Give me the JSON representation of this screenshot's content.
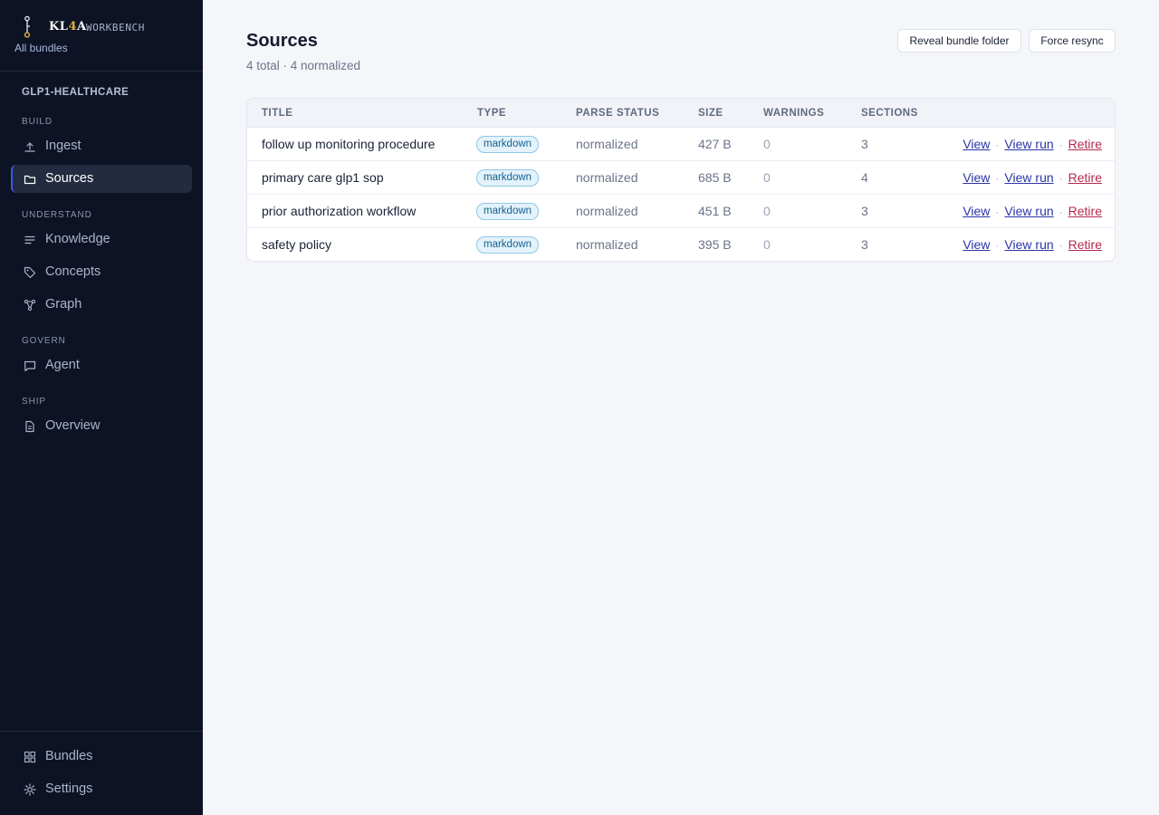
{
  "app": {
    "brand_prefix": "KL",
    "brand_accent": "4",
    "brand_suffix": "A",
    "brand_sub": "WORKBENCH",
    "back_link": "All bundles"
  },
  "sidebar": {
    "bundle_name": "GLP1-HEALTHCARE",
    "sections": {
      "build": "BUILD",
      "understand": "UNDERSTAND",
      "govern": "GOVERN",
      "ship": "SHIP"
    },
    "items": [
      {
        "label": "Ingest",
        "icon": "upload-icon"
      },
      {
        "label": "Sources",
        "icon": "folder-icon",
        "active": true
      },
      {
        "label": "Knowledge",
        "icon": "list-icon"
      },
      {
        "label": "Concepts",
        "icon": "tag-icon"
      },
      {
        "label": "Graph",
        "icon": "graph-icon"
      },
      {
        "label": "Agent",
        "icon": "chat-icon"
      },
      {
        "label": "Overview",
        "icon": "document-icon"
      }
    ],
    "bottom": [
      {
        "label": "Bundles",
        "icon": "grid-icon"
      },
      {
        "label": "Settings",
        "icon": "gear-icon"
      }
    ]
  },
  "main": {
    "title": "Sources",
    "subtitle": "4 total · 4 normalized",
    "buttons": {
      "reveal": "Reveal bundle folder",
      "resync": "Force resync"
    },
    "table": {
      "headers": [
        "TITLE",
        "TYPE",
        "PARSE STATUS",
        "SIZE",
        "WARNINGS",
        "SECTIONS"
      ],
      "rows": [
        {
          "title": "follow up monitoring procedure",
          "type": "markdown",
          "status": "normalized",
          "size": "427 B",
          "warnings": "0",
          "sections": "3"
        },
        {
          "title": "primary care glp1 sop",
          "type": "markdown",
          "status": "normalized",
          "size": "685 B",
          "warnings": "0",
          "sections": "4"
        },
        {
          "title": "prior authorization workflow",
          "type": "markdown",
          "status": "normalized",
          "size": "451 B",
          "warnings": "0",
          "sections": "3"
        },
        {
          "title": "safety policy",
          "type": "markdown",
          "status": "normalized",
          "size": "395 B",
          "warnings": "0",
          "sections": "3"
        }
      ],
      "actions": {
        "view": "View",
        "view_run": "View run",
        "retire": "Retire",
        "separator": "·"
      }
    }
  },
  "colors": {
    "sidebar_bg": "#0d1324",
    "accent": "#3b5bd9",
    "brand_accent": "#e0b13a",
    "link": "#2a35a8",
    "danger": "#b5294e",
    "badge_bg": "#e4f2fb"
  }
}
